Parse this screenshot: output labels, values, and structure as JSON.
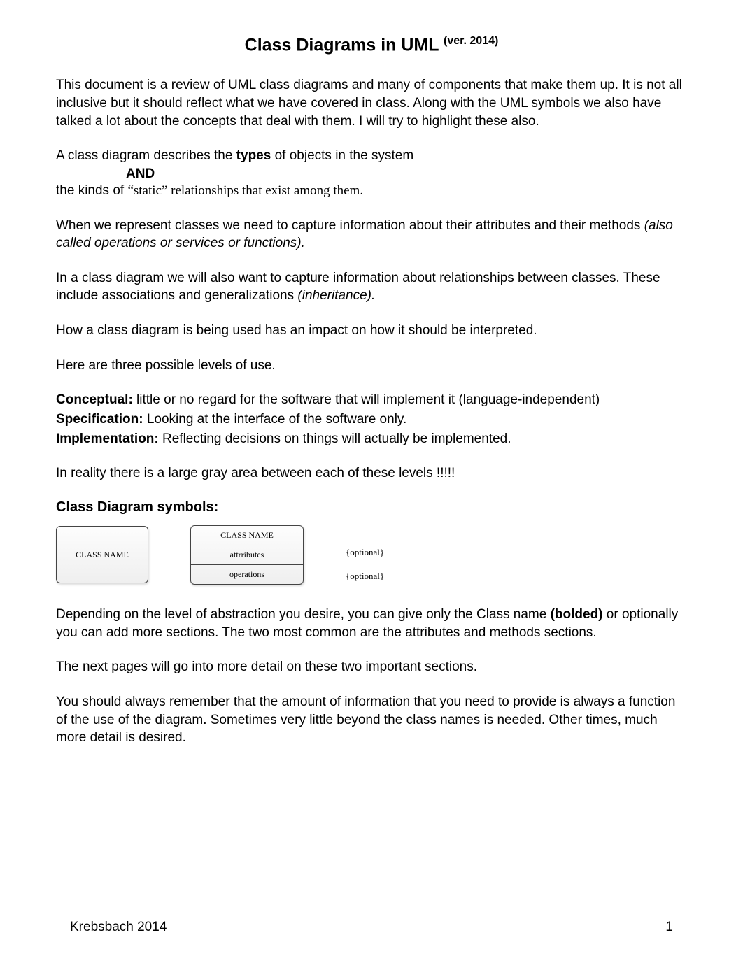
{
  "title_main": "Class Diagrams in UML",
  "title_sup": "(ver. 2014)",
  "intro_full": "This document is a review of UML class diagrams and many of components that make them up. It is not all inclusive but it should reflect what we have covered in class. Along with the UML symbols we also have talked a lot about the concepts that deal with them. I will try to highlight these also.",
  "types_line_a": "A class diagram describes the",
  "types_bold": " types ",
  "types_line_b": "of objects in the system",
  "and_word": "AND",
  "static_a": "the kinds of ",
  "static_q": "“static” relationships that exist among them.",
  "attr_a": "When we represent classes we need to capture information about their attributes and their methods ",
  "attr_b": "(also called operations or services or functions).",
  "rel_a": "In a class diagram we will also want to capture information about relationships between classes. These include associations and generalizations ",
  "rel_b": "(inheritance).",
  "impact": "How a class diagram is being used has an impact on how it should be interpreted.",
  "levels_intro": "Here are three possible levels of use.",
  "conc_h": "Conceptual:",
  "conc_t": " little or no regard for the software that will implement it (language-independent)",
  "spec_h": "Specification:",
  "spec_t": " Looking at the interface of the software only.",
  "impl_h": "Implementation:",
  "impl_t": " Reflecting decisions on things will actually be implemented.",
  "gray": "In reality there is a large gray area between each of these levels !!!!!",
  "symbols_h": "Class Diagram symbols:",
  "box_simple": "CLASS NAME",
  "box2_name": "CLASS NAME",
  "box2_attr": "attrributes",
  "box2_ops": "operations",
  "opt1": "{optional}",
  "opt2": "{optional}",
  "depend_a": "Depending on the level of abstraction you desire, you can give only the Class name ",
  "depend_b": "(bolded)",
  "depend_c": " or optionally you can add more sections. The two most common are the attributes and methods sections.",
  "next": "The next pages will go into more detail on these two important sections.",
  "remember": "You should always remember that the amount of information that you need to provide is always a function of the use of the diagram. Sometimes very little beyond the class names is needed. Other times, much more detail is desired.",
  "footer_left": "Krebsbach 2014",
  "footer_right": "1"
}
